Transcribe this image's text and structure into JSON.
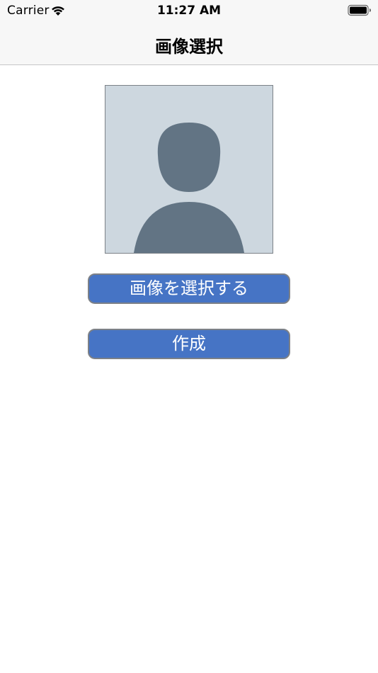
{
  "status_bar": {
    "carrier": "Carrier",
    "time": "11:27 AM",
    "wifi_icon": "wifi-icon",
    "battery_icon": "battery-icon"
  },
  "nav": {
    "title": "画像選択"
  },
  "preview": {
    "icon": "person-placeholder-icon",
    "background_color": "#cdd7df",
    "figure_color": "#627484"
  },
  "buttons": {
    "select_label": "画像を選択する",
    "create_label": "作成"
  },
  "colors": {
    "button": "#4674c5",
    "button_border": "#7d8187",
    "bar_background": "#f7f7f7"
  }
}
